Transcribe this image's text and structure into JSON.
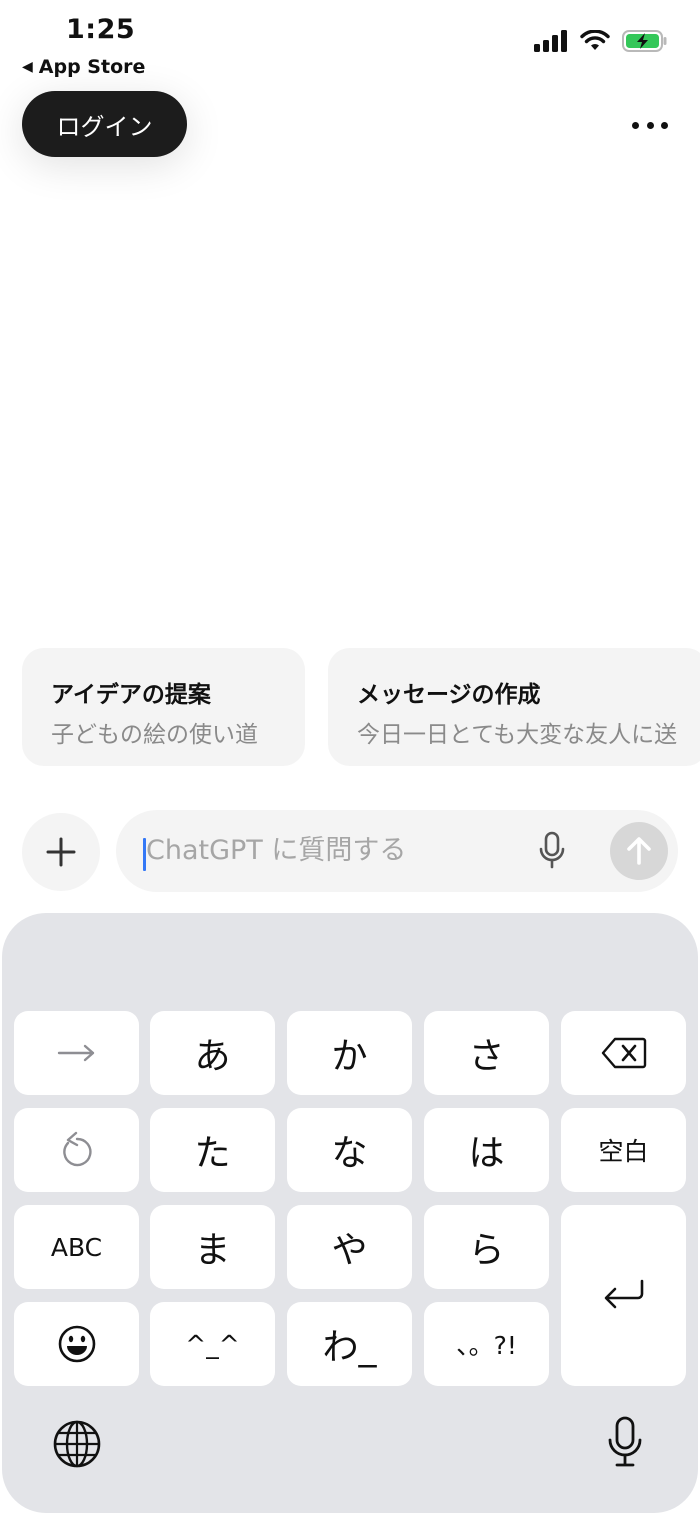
{
  "status_bar": {
    "time": "1:25",
    "back_label": "App Store",
    "icons": [
      "cellular-signal-icon",
      "wifi-icon",
      "battery-charging-icon"
    ]
  },
  "header": {
    "login_label": "ログイン",
    "more_icon": "ellipsis-icon"
  },
  "suggestions": [
    {
      "title": "アイデアの提案",
      "subtitle": "子どもの絵の使い道"
    },
    {
      "title": "メッセージの作成",
      "subtitle": "今日一日とても大変な友人に送"
    }
  ],
  "composer": {
    "placeholder": "ChatGPT に質問する",
    "value": "",
    "plus_icon": "plus-icon",
    "mic_icon": "microphone-icon",
    "send_icon": "arrow-up-icon"
  },
  "keyboard": {
    "rows": [
      [
        "→",
        "あ",
        "か",
        "さ",
        "⌫"
      ],
      [
        "↺",
        "た",
        "な",
        "は",
        "空白"
      ],
      [
        "ABC",
        "ま",
        "や",
        "ら",
        "⏎"
      ],
      [
        "☺",
        "^_^",
        "わ_",
        "、。?!"
      ]
    ],
    "labels": {
      "arrow": "→",
      "a": "あ",
      "ka": "か",
      "sa": "さ",
      "ta": "た",
      "na": "な",
      "ha": "は",
      "space": "空白",
      "abc": "ABC",
      "ma": "ま",
      "ya": "や",
      "ra": "ら",
      "kaomoji": "^_^",
      "wa": "わ_",
      "punct": "、。?!"
    },
    "bottom_icons": [
      "globe-icon",
      "dictation-mic-icon"
    ]
  },
  "colors": {
    "login_bg": "#1c1c1c",
    "caret": "#3478f6",
    "keyboard_bg": "#e3e4e8",
    "battery_green": "#34c759"
  }
}
